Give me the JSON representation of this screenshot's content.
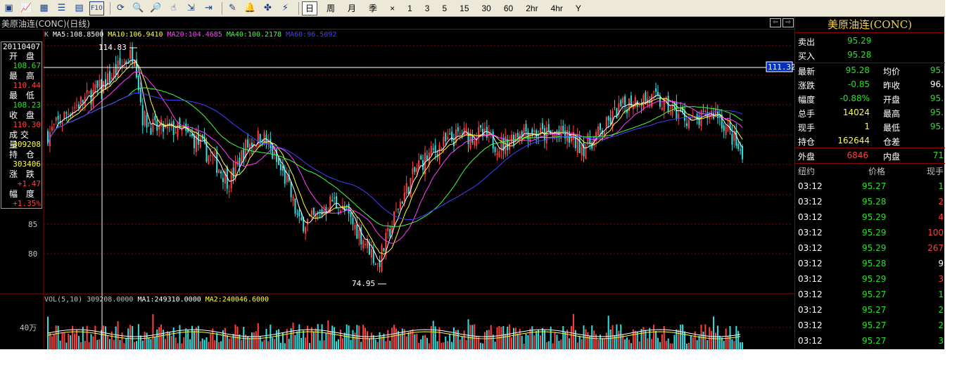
{
  "colors": {
    "up": "#ff4040",
    "down": "#30e0e0",
    "bg": "#000000",
    "grid": "#8b0000"
  },
  "toolbar": {
    "icons": [
      "chart-window-icon",
      "line-chart-icon",
      "grid-chart-icon",
      "list-icon",
      "table-icon",
      "f10-icon",
      "refresh-icon",
      "zoom-in-icon",
      "zoom-out-icon",
      "pointer-icon",
      "export-icon",
      "import-icon",
      "draw-pen-icon",
      "alert-bell-icon",
      "indicator-icon",
      "flash-icon"
    ],
    "icon_glyphs": [
      "▣",
      "📈",
      "▦",
      "☰",
      "▤",
      "F10",
      "⟳",
      "🔍",
      "🔎",
      "☝",
      "⇲",
      "⇥",
      "✎",
      "🔔",
      "✤",
      "⚡"
    ],
    "periods": [
      "日",
      "周",
      "月",
      "季",
      "×",
      "1",
      "3",
      "5",
      "15",
      "30",
      "60",
      "2hr",
      "4hr",
      "Y"
    ],
    "active_period": "日"
  },
  "chart": {
    "title": "美原油连(CONC)(日线)",
    "ma_items": [
      {
        "label": "K",
        "color": "#c0c0c0"
      },
      {
        "label": "MA5:108.8500",
        "color": "#ffffff"
      },
      {
        "label": "MA10:106.9410",
        "color": "#ffff40"
      },
      {
        "label": "MA20:104.4685",
        "color": "#ff40ff"
      },
      {
        "label": "MA40:100.2178",
        "color": "#40ff40"
      },
      {
        "label": "MA60:96.5092",
        "color": "#4040ff"
      }
    ],
    "vol_items": [
      {
        "label": "VOL(5,10) 309208.0000",
        "color": "#c0c0c0"
      },
      {
        "label": "MA1:249310.0000",
        "color": "#ffffff"
      },
      {
        "label": "MA2:240046.6000",
        "color": "#ffff40"
      }
    ],
    "y_ticks": [
      "85",
      "80"
    ],
    "vol_tick": "40万",
    "high_label": "114.83",
    "low_label": "74.95",
    "cursor_price": "111.32"
  },
  "info_box": {
    "date": "20110407",
    "rows": [
      {
        "label": "开 盘",
        "value": "108.67",
        "color": "#28e028"
      },
      {
        "label": "最 高",
        "value": "110.44",
        "color": "#ff4040"
      },
      {
        "label": "最 低",
        "value": "108.23",
        "color": "#28e028"
      },
      {
        "label": "收 盘",
        "value": "110.30",
        "color": "#ff4040"
      },
      {
        "label": "成交量",
        "value": "309208",
        "color": "#ffff40"
      },
      {
        "label": "持 仓",
        "value": "303406",
        "color": "#ffff40"
      },
      {
        "label": "涨 跌",
        "value": "+1.47",
        "color": "#ff4040"
      },
      {
        "label": "幅 度",
        "value": "+1.35%",
        "color": "#ff4040"
      }
    ]
  },
  "quote": {
    "title": "美原油连(CONC)",
    "sell_label": "卖出",
    "sell": "95.29",
    "buy_label": "买入",
    "buy": "95.28",
    "rows": [
      {
        "l1": "最新",
        "v1": "95.28",
        "c1": "c-green",
        "l2": "均价",
        "v2": "95.",
        "c2": "c-green"
      },
      {
        "l1": "涨跌",
        "v1": "-0.85",
        "c1": "c-green",
        "l2": "昨收",
        "v2": "96.",
        "c2": "c-white"
      },
      {
        "l1": "幅度",
        "v1": "-0.88%",
        "c1": "c-green",
        "l2": "开盘",
        "v2": "95.",
        "c2": "c-green"
      },
      {
        "l1": "总手",
        "v1": "14024",
        "c1": "c-yellow",
        "l2": "最高",
        "v2": "95.",
        "c2": "c-green"
      },
      {
        "l1": "现手",
        "v1": "1",
        "c1": "c-yellow",
        "l2": "最低",
        "v2": "95.",
        "c2": "c-green"
      },
      {
        "l1": "持仓",
        "v1": "162644",
        "c1": "c-yellow",
        "l2": "仓差",
        "v2": "",
        "c2": "c-white"
      }
    ],
    "outer_label": "外盘",
    "outer": "6846",
    "inner_label": "内盘",
    "inner": "71",
    "trade_header": {
      "time": "纽约",
      "price": "价格",
      "vol": "现手"
    },
    "trades": [
      {
        "time": "03:12",
        "price": "95.27",
        "vol": "1",
        "vc": "c-green"
      },
      {
        "time": "03:12",
        "price": "95.28",
        "vol": "2",
        "vc": "c-red"
      },
      {
        "time": "03:12",
        "price": "95.29",
        "vol": "4",
        "vc": "c-red"
      },
      {
        "time": "03:12",
        "price": "95.29",
        "vol": "100",
        "vc": "c-red"
      },
      {
        "time": "03:12",
        "price": "95.29",
        "vol": "267",
        "vc": "c-red"
      },
      {
        "time": "03:12",
        "price": "95.28",
        "vol": "9",
        "vc": "c-white"
      },
      {
        "time": "03:12",
        "price": "95.29",
        "vol": "3",
        "vc": "c-red"
      },
      {
        "time": "03:12",
        "price": "95.27",
        "vol": "1",
        "vc": "c-green"
      },
      {
        "time": "03:12",
        "price": "95.27",
        "vol": "2",
        "vc": "c-green"
      },
      {
        "time": "03:12",
        "price": "95.27",
        "vol": "2",
        "vc": "c-green"
      },
      {
        "time": "03:12",
        "price": "95.27",
        "vol": "3",
        "vc": "c-green"
      }
    ]
  }
}
